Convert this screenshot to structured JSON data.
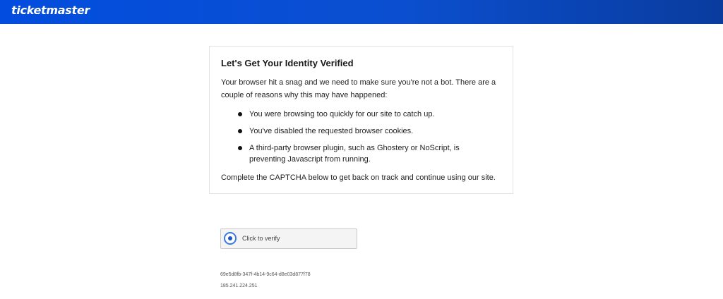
{
  "header": {
    "brand": "ticketmaster",
    "background_color": "#024ddf"
  },
  "card": {
    "title": "Let's Get Your Identity Verified",
    "intro": "Your browser hit a snag and we need to make sure you're not a bot. There are a couple of reasons why this may have happened:",
    "reasons": [
      "You were browsing too quickly for our site to catch up.",
      "You've disabled the requested browser cookies.",
      "A third-party browser plugin, such as Ghostery or NoScript, is preventing Javascript from running."
    ],
    "outro": "Complete the CAPTCHA below to get back on track and continue using our site."
  },
  "captcha": {
    "label": "Click to verify",
    "icon": "captcha-radio-icon"
  },
  "meta": {
    "request_id": "69e5d8fb-347f-4b14-9c64-d8e03d877f78",
    "ip": "185.241.224.251"
  }
}
